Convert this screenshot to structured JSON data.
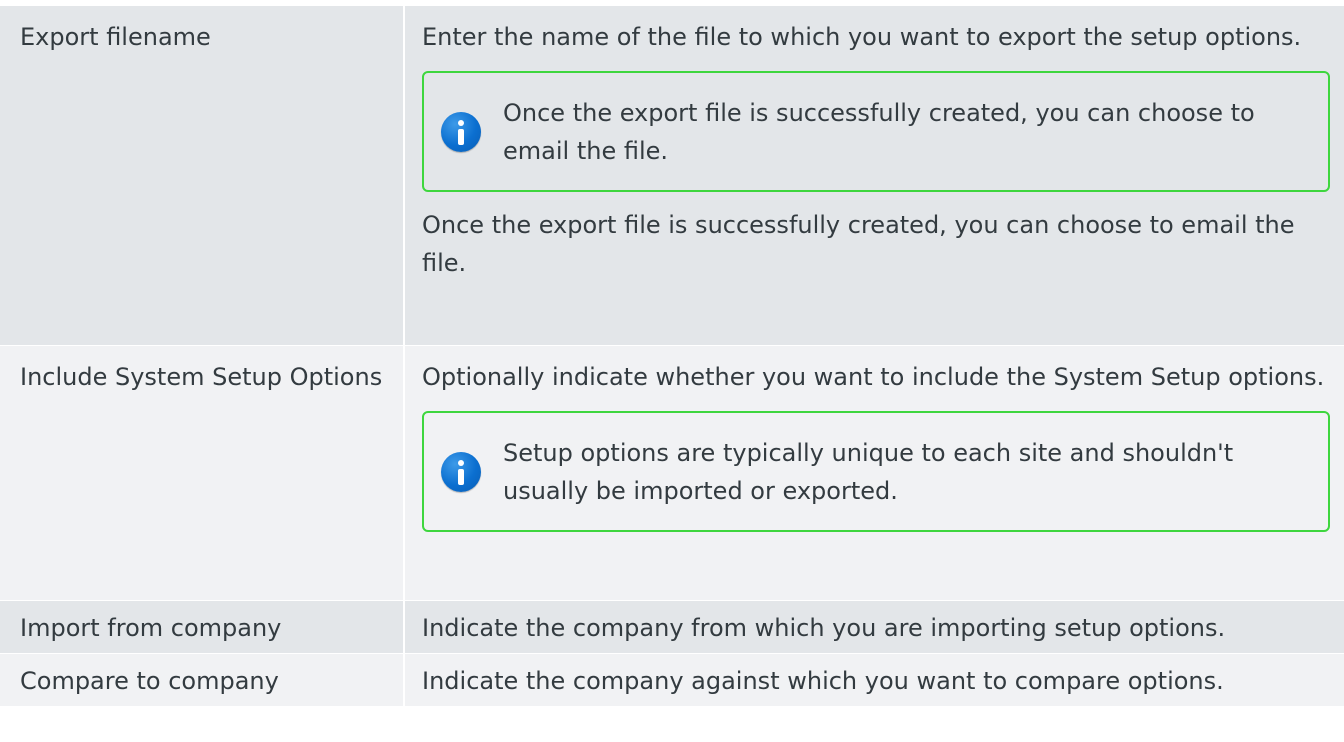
{
  "rows": [
    {
      "name": "Export filename",
      "desc": "Enter the name of the file to which you want to export the setup options.",
      "note": "Once the export file is successfully created, you can choose to email the file.",
      "after": "Once the export file is successfully created, you can choose to email the file."
    },
    {
      "name": "Include System Setup Options",
      "desc": "Optionally indicate whether you want to include the System Setup options.",
      "note": "Setup options are typically unique to each site and shouldn't usually be imported or exported."
    },
    {
      "name": "Import from company",
      "desc": "Indicate the company from which you are importing setup options."
    },
    {
      "name": "Compare to company",
      "desc": "Indicate the company against which you want to compare options."
    }
  ],
  "icons": {
    "note_icon": "info-icon"
  },
  "colors": {
    "row_shaded": "#e3e6e9",
    "row_light": "#f1f2f4",
    "note_border": "#3ed63e",
    "info_icon": "#0b6fd0"
  }
}
